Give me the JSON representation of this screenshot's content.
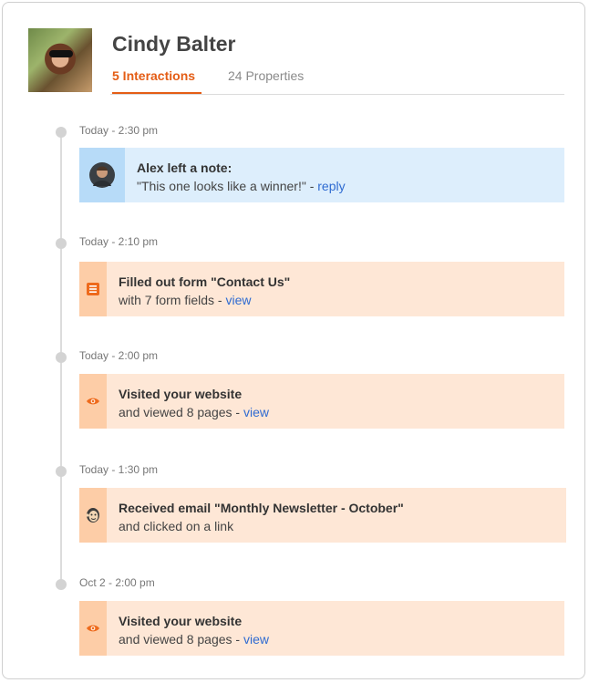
{
  "profile": {
    "name": "Cindy Balter",
    "tabs": [
      {
        "label": "5 Interactions",
        "active": true
      },
      {
        "label": "24 Properties",
        "active": false
      }
    ]
  },
  "colors": {
    "accent": "#e45d15",
    "link": "#2f6bd1",
    "activity_bg": "#fee7d6",
    "activity_strip": "#fdcda7",
    "note_bg": "#ddeefc",
    "note_strip": "#b7dbf8"
  },
  "events": [
    {
      "time": "Today - 2:30 pm",
      "icon": "user-avatar-icon",
      "title": "Alex left a note:",
      "detail": "\"This one looks like a winner!\" - ",
      "link": "reply"
    },
    {
      "time": "Today - 2:10 pm",
      "icon": "form-icon",
      "title": "Filled out form \"Contact Us\"",
      "detail": "with 7 form fields - ",
      "link": "view"
    },
    {
      "time": "Today - 2:00 pm",
      "icon": "eye-icon",
      "title": "Visited your website",
      "detail": "and viewed 8 pages - ",
      "link": "view"
    },
    {
      "time": "Today - 1:30 pm",
      "icon": "mailchimp-icon",
      "title": "Received email \"Monthly Newsletter - October\"",
      "detail": "and clicked on a link",
      "link": ""
    },
    {
      "time": "Oct 2 - 2:00 pm",
      "icon": "eye-icon",
      "title": "Visited your website",
      "detail": "and viewed 8 pages - ",
      "link": "view"
    }
  ]
}
